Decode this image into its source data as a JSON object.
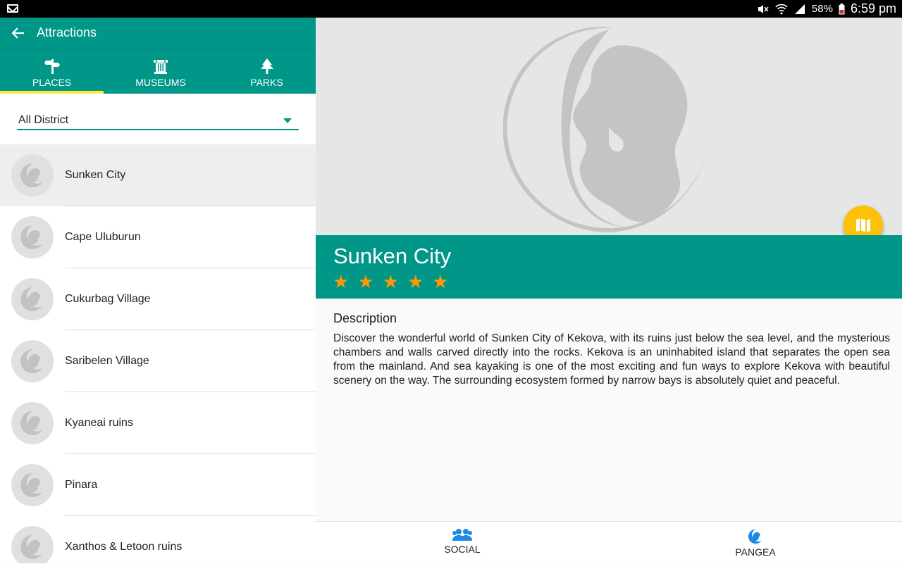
{
  "status_bar": {
    "battery": "58%",
    "time": "6:59 pm",
    "icons": [
      "mail-icon",
      "mute-icon",
      "wifi-icon",
      "signal-icon",
      "battery-icon"
    ]
  },
  "appbar": {
    "title": "Attractions",
    "back_icon": "arrow-back-icon"
  },
  "tabs": [
    {
      "label": "PLACES",
      "icon": "signpost-icon",
      "selected": true
    },
    {
      "label": "MUSEUMS",
      "icon": "museum-icon",
      "selected": false
    },
    {
      "label": "PARKS",
      "icon": "park-icon",
      "selected": false
    }
  ],
  "filter": {
    "selected": "All District"
  },
  "places": [
    {
      "name": "Sunken City",
      "selected": true
    },
    {
      "name": "Cape Uluburun"
    },
    {
      "name": "Cukurbag Village"
    },
    {
      "name": "Saribelen Village"
    },
    {
      "name": "Kyaneai ruins"
    },
    {
      "name": "Pinara"
    },
    {
      "name": "Xanthos & Letoon ruins"
    }
  ],
  "detail": {
    "title": "Sunken City",
    "rating": 5,
    "stars": [
      "★",
      "★",
      "★",
      "★",
      "★"
    ],
    "description_heading": "Description",
    "description": "Discover the wonderful world of Sunken City of Kekova, with its ruins just below the sea level, and the mysterious chambers and walls carved directly into the rocks. Kekova is an uninhabited island that separates the open sea from the mainland. And sea kayaking is one of the most exciting and fun ways to explore Kekova with beautiful scenery on the way. The surrounding ecosystem formed by narrow bays is absolutely quiet and peaceful.",
    "map_button_icon": "map-icon"
  },
  "bottom_nav": [
    {
      "label": "SOCIAL",
      "icon": "people-icon"
    },
    {
      "label": "PANGEA",
      "icon": "pangea-logo-icon"
    }
  ],
  "colors": {
    "primary": "#009688",
    "accent": "#ffc107",
    "tab_indicator": "#ffeb3b",
    "star": "#ff9800"
  }
}
